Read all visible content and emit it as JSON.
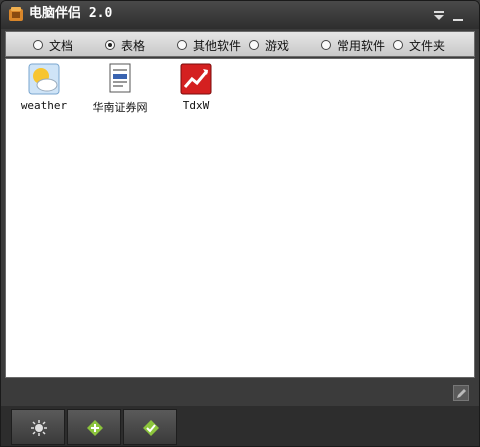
{
  "window": {
    "title": "电脑伴侣 2.0"
  },
  "categories": [
    {
      "label": "文档",
      "checked": false
    },
    {
      "label": "表格",
      "checked": true
    },
    {
      "label": "其他软件",
      "checked": false
    },
    {
      "label": "游戏",
      "checked": false
    },
    {
      "label": "常用软件",
      "checked": false
    },
    {
      "label": "文件夹",
      "checked": false
    }
  ],
  "items": [
    {
      "label": "weather",
      "icon": "weather-icon"
    },
    {
      "label": "华南证券网",
      "icon": "web-document-icon"
    },
    {
      "label": "TdxW",
      "icon": "stock-chart-icon"
    }
  ],
  "toolbar": {
    "buttons": [
      {
        "icon": "settings-sun-icon"
      },
      {
        "icon": "add-item-icon"
      },
      {
        "icon": "check-edit-icon"
      }
    ]
  },
  "colors": {
    "title_bar": "#2e2e2e",
    "category_bar": "#d8d8d8",
    "content_bg": "#ffffff",
    "tdxw_red": "#d42020"
  }
}
